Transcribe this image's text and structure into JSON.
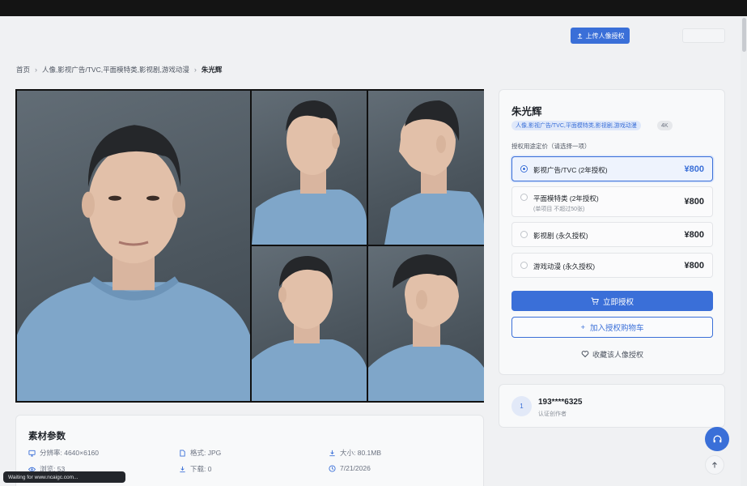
{
  "header": {
    "upload_label": "上传人像授权"
  },
  "breadcrumb": {
    "home": "首页",
    "category": "人像,影视广告/TVC,平面模特类,影视剧,游戏动漫",
    "current": "朱光辉"
  },
  "asset": {
    "name": "朱光辉",
    "tags": [
      "人像,影视广告/TVC,平面模特类,影视剧,游戏动漫",
      "4K"
    ]
  },
  "pricing": {
    "label": "授权用途定价（请选择一项）",
    "options": [
      {
        "label": "影视广告/TVC (2年授权)",
        "sub": "",
        "price": "¥800",
        "selected": true
      },
      {
        "label": "平面模特类 (2年授权)",
        "sub": "(单项目 不超过50张)",
        "price": "¥800",
        "selected": false
      },
      {
        "label": "影视剧 (永久授权)",
        "sub": "",
        "price": "¥800",
        "selected": false
      },
      {
        "label": "游戏动漫 (永久授权)",
        "sub": "",
        "price": "¥800",
        "selected": false
      }
    ]
  },
  "actions": {
    "buy_label": "立即授权",
    "cart_label": "加入授权购物车",
    "favorite_label": "收藏该人像授权"
  },
  "author": {
    "avatar_text": "1",
    "name": "193****6325",
    "role": "认证创作者"
  },
  "params": {
    "title": "素材参数",
    "resolution": "分辨率: 4640×6160",
    "format": "格式: JPG",
    "size": "大小: 80.1MB",
    "views": "浏览: 53",
    "downloads": "下载: 0",
    "date": "7/21/2026"
  },
  "status_bar": {
    "text": "Waiting for www.ncaigc.com..."
  },
  "colors": {
    "accent": "#3a6fd8",
    "background": "#f0f1f3",
    "card": "#f8f9fa"
  },
  "icons": {
    "upload": "upload-icon",
    "cart": "cart-icon",
    "plus": "plus-icon",
    "heart": "heart-icon",
    "support": "headset-icon",
    "back_to_top": "arrow-up-icon"
  }
}
